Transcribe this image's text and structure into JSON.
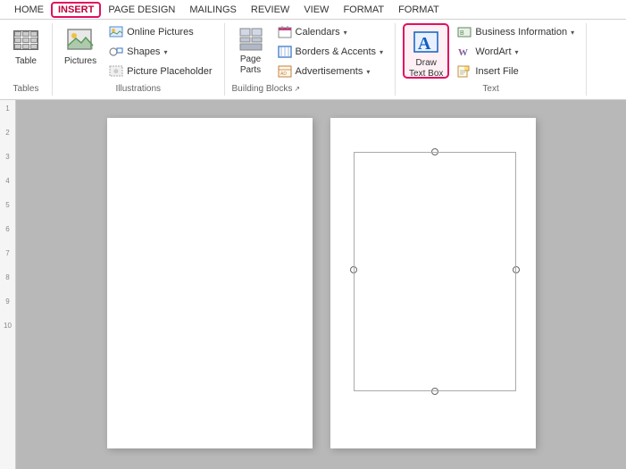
{
  "menu": {
    "items": [
      {
        "label": "HOME",
        "active": false
      },
      {
        "label": "INSERT",
        "active": true
      },
      {
        "label": "PAGE DESIGN",
        "active": false
      },
      {
        "label": "MAILINGS",
        "active": false
      },
      {
        "label": "REVIEW",
        "active": false
      },
      {
        "label": "VIEW",
        "active": false
      },
      {
        "label": "FORMAT",
        "active": false
      },
      {
        "label": "FORMAT",
        "active": false
      }
    ]
  },
  "ribbon": {
    "groups": [
      {
        "name": "Tables",
        "label": "Tables",
        "buttons": [
          {
            "id": "table",
            "label": "Table",
            "icon": "table"
          }
        ]
      },
      {
        "name": "Illustrations",
        "label": "Illustrations",
        "buttons": [
          {
            "id": "pictures",
            "label": "Pictures",
            "icon": "pictures"
          },
          {
            "id": "online-pictures",
            "label": "Online Pictures",
            "icon": "online-pictures"
          },
          {
            "id": "shapes",
            "label": "Shapes",
            "icon": "shapes"
          },
          {
            "id": "picture-placeholder",
            "label": "Picture Placeholder",
            "icon": "picture-placeholder"
          }
        ]
      },
      {
        "name": "BuildingBlocks",
        "label": "Building Blocks",
        "buttons": [
          {
            "id": "page-parts",
            "label": "Page Parts",
            "icon": "page-parts"
          },
          {
            "id": "calendars",
            "label": "Calendars",
            "icon": "calendars"
          },
          {
            "id": "borders-accents",
            "label": "Borders & Accents",
            "icon": "borders-accents"
          },
          {
            "id": "advertisements",
            "label": "Advertisements",
            "icon": "advertisements"
          }
        ]
      },
      {
        "name": "Text",
        "label": "Text",
        "highlighted": true,
        "buttons": [
          {
            "id": "draw-text-box",
            "label": "Draw\nText Box",
            "icon": "draw-text-box",
            "highlighted": true
          },
          {
            "id": "business-information",
            "label": "Business Information",
            "icon": "business-info"
          },
          {
            "id": "wordart",
            "label": "WordArt",
            "icon": "wordart"
          },
          {
            "id": "insert-file",
            "label": "Insert File",
            "icon": "insert-file"
          }
        ]
      }
    ]
  },
  "ruler": {
    "marks": [
      "1",
      "2",
      "3",
      "4",
      "5",
      "6",
      "7",
      "8",
      "9",
      "10"
    ]
  },
  "document": {
    "pages": 2
  }
}
